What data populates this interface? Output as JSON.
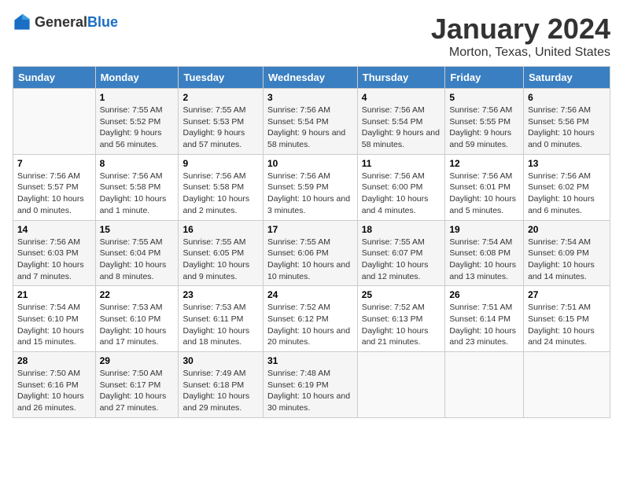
{
  "logo": {
    "general": "General",
    "blue": "Blue"
  },
  "title": "January 2024",
  "subtitle": "Morton, Texas, United States",
  "headers": [
    "Sunday",
    "Monday",
    "Tuesday",
    "Wednesday",
    "Thursday",
    "Friday",
    "Saturday"
  ],
  "weeks": [
    [
      {
        "num": "",
        "sunrise": "",
        "sunset": "",
        "daylight": ""
      },
      {
        "num": "1",
        "sunrise": "Sunrise: 7:55 AM",
        "sunset": "Sunset: 5:52 PM",
        "daylight": "Daylight: 9 hours and 56 minutes."
      },
      {
        "num": "2",
        "sunrise": "Sunrise: 7:55 AM",
        "sunset": "Sunset: 5:53 PM",
        "daylight": "Daylight: 9 hours and 57 minutes."
      },
      {
        "num": "3",
        "sunrise": "Sunrise: 7:56 AM",
        "sunset": "Sunset: 5:54 PM",
        "daylight": "Daylight: 9 hours and 58 minutes."
      },
      {
        "num": "4",
        "sunrise": "Sunrise: 7:56 AM",
        "sunset": "Sunset: 5:54 PM",
        "daylight": "Daylight: 9 hours and 58 minutes."
      },
      {
        "num": "5",
        "sunrise": "Sunrise: 7:56 AM",
        "sunset": "Sunset: 5:55 PM",
        "daylight": "Daylight: 9 hours and 59 minutes."
      },
      {
        "num": "6",
        "sunrise": "Sunrise: 7:56 AM",
        "sunset": "Sunset: 5:56 PM",
        "daylight": "Daylight: 10 hours and 0 minutes."
      }
    ],
    [
      {
        "num": "7",
        "sunrise": "Sunrise: 7:56 AM",
        "sunset": "Sunset: 5:57 PM",
        "daylight": "Daylight: 10 hours and 0 minutes."
      },
      {
        "num": "8",
        "sunrise": "Sunrise: 7:56 AM",
        "sunset": "Sunset: 5:58 PM",
        "daylight": "Daylight: 10 hours and 1 minute."
      },
      {
        "num": "9",
        "sunrise": "Sunrise: 7:56 AM",
        "sunset": "Sunset: 5:58 PM",
        "daylight": "Daylight: 10 hours and 2 minutes."
      },
      {
        "num": "10",
        "sunrise": "Sunrise: 7:56 AM",
        "sunset": "Sunset: 5:59 PM",
        "daylight": "Daylight: 10 hours and 3 minutes."
      },
      {
        "num": "11",
        "sunrise": "Sunrise: 7:56 AM",
        "sunset": "Sunset: 6:00 PM",
        "daylight": "Daylight: 10 hours and 4 minutes."
      },
      {
        "num": "12",
        "sunrise": "Sunrise: 7:56 AM",
        "sunset": "Sunset: 6:01 PM",
        "daylight": "Daylight: 10 hours and 5 minutes."
      },
      {
        "num": "13",
        "sunrise": "Sunrise: 7:56 AM",
        "sunset": "Sunset: 6:02 PM",
        "daylight": "Daylight: 10 hours and 6 minutes."
      }
    ],
    [
      {
        "num": "14",
        "sunrise": "Sunrise: 7:56 AM",
        "sunset": "Sunset: 6:03 PM",
        "daylight": "Daylight: 10 hours and 7 minutes."
      },
      {
        "num": "15",
        "sunrise": "Sunrise: 7:55 AM",
        "sunset": "Sunset: 6:04 PM",
        "daylight": "Daylight: 10 hours and 8 minutes."
      },
      {
        "num": "16",
        "sunrise": "Sunrise: 7:55 AM",
        "sunset": "Sunset: 6:05 PM",
        "daylight": "Daylight: 10 hours and 9 minutes."
      },
      {
        "num": "17",
        "sunrise": "Sunrise: 7:55 AM",
        "sunset": "Sunset: 6:06 PM",
        "daylight": "Daylight: 10 hours and 10 minutes."
      },
      {
        "num": "18",
        "sunrise": "Sunrise: 7:55 AM",
        "sunset": "Sunset: 6:07 PM",
        "daylight": "Daylight: 10 hours and 12 minutes."
      },
      {
        "num": "19",
        "sunrise": "Sunrise: 7:54 AM",
        "sunset": "Sunset: 6:08 PM",
        "daylight": "Daylight: 10 hours and 13 minutes."
      },
      {
        "num": "20",
        "sunrise": "Sunrise: 7:54 AM",
        "sunset": "Sunset: 6:09 PM",
        "daylight": "Daylight: 10 hours and 14 minutes."
      }
    ],
    [
      {
        "num": "21",
        "sunrise": "Sunrise: 7:54 AM",
        "sunset": "Sunset: 6:10 PM",
        "daylight": "Daylight: 10 hours and 15 minutes."
      },
      {
        "num": "22",
        "sunrise": "Sunrise: 7:53 AM",
        "sunset": "Sunset: 6:10 PM",
        "daylight": "Daylight: 10 hours and 17 minutes."
      },
      {
        "num": "23",
        "sunrise": "Sunrise: 7:53 AM",
        "sunset": "Sunset: 6:11 PM",
        "daylight": "Daylight: 10 hours and 18 minutes."
      },
      {
        "num": "24",
        "sunrise": "Sunrise: 7:52 AM",
        "sunset": "Sunset: 6:12 PM",
        "daylight": "Daylight: 10 hours and 20 minutes."
      },
      {
        "num": "25",
        "sunrise": "Sunrise: 7:52 AM",
        "sunset": "Sunset: 6:13 PM",
        "daylight": "Daylight: 10 hours and 21 minutes."
      },
      {
        "num": "26",
        "sunrise": "Sunrise: 7:51 AM",
        "sunset": "Sunset: 6:14 PM",
        "daylight": "Daylight: 10 hours and 23 minutes."
      },
      {
        "num": "27",
        "sunrise": "Sunrise: 7:51 AM",
        "sunset": "Sunset: 6:15 PM",
        "daylight": "Daylight: 10 hours and 24 minutes."
      }
    ],
    [
      {
        "num": "28",
        "sunrise": "Sunrise: 7:50 AM",
        "sunset": "Sunset: 6:16 PM",
        "daylight": "Daylight: 10 hours and 26 minutes."
      },
      {
        "num": "29",
        "sunrise": "Sunrise: 7:50 AM",
        "sunset": "Sunset: 6:17 PM",
        "daylight": "Daylight: 10 hours and 27 minutes."
      },
      {
        "num": "30",
        "sunrise": "Sunrise: 7:49 AM",
        "sunset": "Sunset: 6:18 PM",
        "daylight": "Daylight: 10 hours and 29 minutes."
      },
      {
        "num": "31",
        "sunrise": "Sunrise: 7:48 AM",
        "sunset": "Sunset: 6:19 PM",
        "daylight": "Daylight: 10 hours and 30 minutes."
      },
      {
        "num": "",
        "sunrise": "",
        "sunset": "",
        "daylight": ""
      },
      {
        "num": "",
        "sunrise": "",
        "sunset": "",
        "daylight": ""
      },
      {
        "num": "",
        "sunrise": "",
        "sunset": "",
        "daylight": ""
      }
    ]
  ]
}
